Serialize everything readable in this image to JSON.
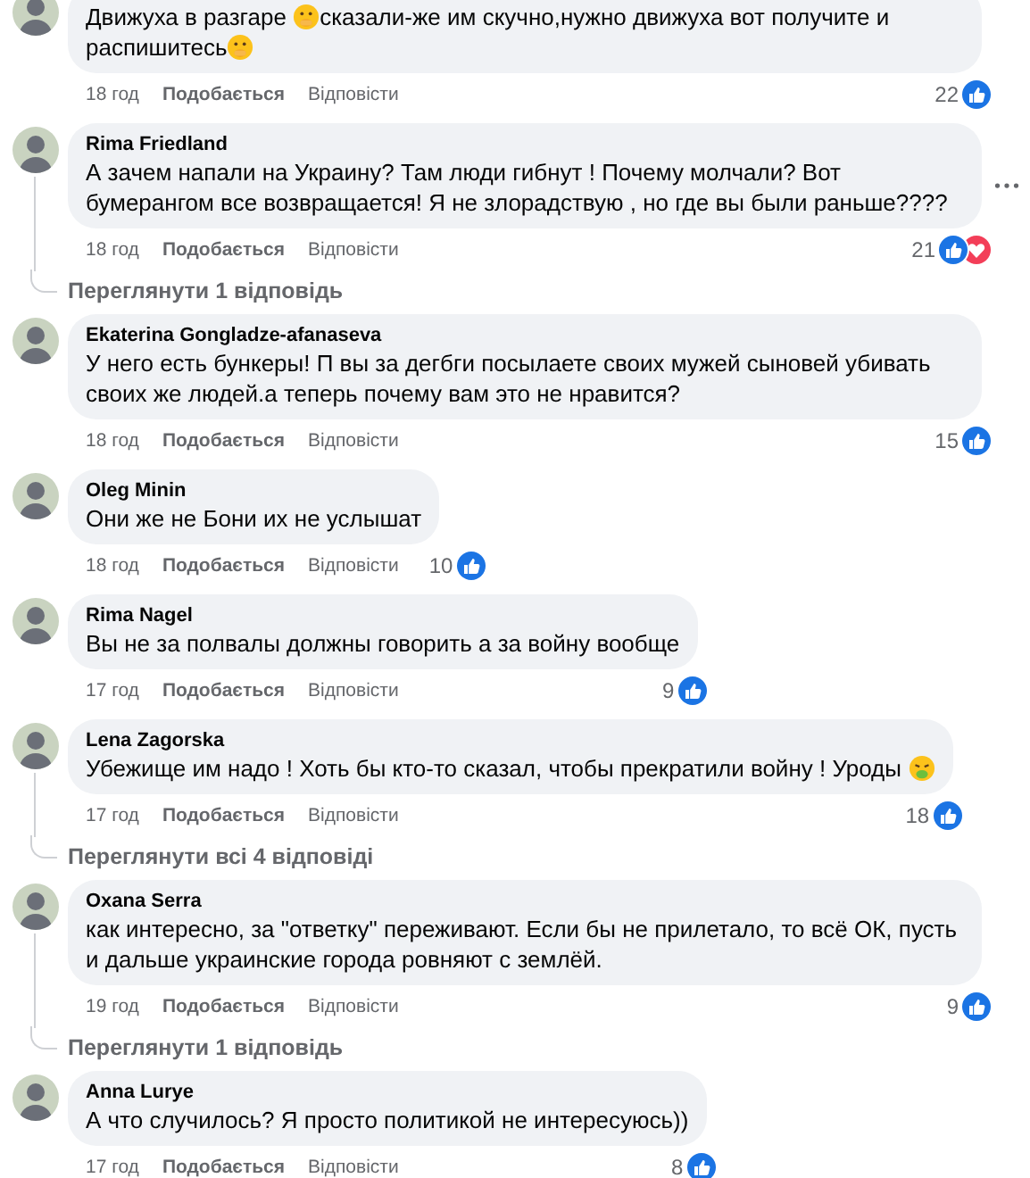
{
  "comments": [
    {
      "parts": [
        {
          "kind": "text",
          "text": "Движуха в разгаре "
        },
        {
          "kind": "emoji"
        },
        {
          "kind": "text",
          "text": "сказали-же им скучно,нужно движуха вот получите и распишитесь"
        },
        {
          "kind": "emoji"
        }
      ],
      "time": "18 год",
      "like": "Подобається",
      "reply": "Відповісти",
      "count": "22",
      "reactions": [
        {
          "kind": "like"
        }
      ],
      "menu": false
    },
    {
      "author": "Rima Friedland",
      "parts": [
        {
          "kind": "text",
          "text": "А зачем напали на Украину? Там люди гибнут ! Почему молчали? Вот бумерангом все возвращается! Я не злорадствую , но где вы были раньше????"
        }
      ],
      "time": "18 год",
      "like": "Подобається",
      "reply": "Відповісти",
      "count": "21",
      "reactions": [
        {
          "kind": "like"
        },
        {
          "kind": "love"
        }
      ],
      "menu": true,
      "replies_link": "Переглянути 1 відповідь"
    },
    {
      "author": "Ekaterina Gongladze-afanaseva",
      "parts": [
        {
          "kind": "text",
          "text": "У него есть бункеры! П вы за дегбги посылаете своих мужей сыновей убивать своих же людей.а теперь почему вам это не нравится?"
        }
      ],
      "time": "18 год",
      "like": "Подобається",
      "reply": "Відповісти",
      "count": "15",
      "reactions": [
        {
          "kind": "like"
        }
      ],
      "menu": false
    },
    {
      "author": "Oleg Minin",
      "parts": [
        {
          "kind": "text",
          "text": "Они же не Бони их не услышат"
        }
      ],
      "time": "18 год",
      "like": "Подобається",
      "reply": "Відповісти",
      "count": "10",
      "reactions": [
        {
          "kind": "like"
        }
      ],
      "menu": false
    },
    {
      "author": "Rima Nagel",
      "parts": [
        {
          "kind": "text",
          "text": "Вы не за полвалы должны говорить а за войну вообще"
        }
      ],
      "time": "17 год",
      "like": "Подобається",
      "reply": "Відповісти",
      "count": "9",
      "reactions": [
        {
          "kind": "like"
        }
      ],
      "menu": false
    },
    {
      "author": "Lena Zagorska",
      "parts": [
        {
          "kind": "text",
          "text": "Убежище им надо ! Хоть бы кто-то сказал, чтобы прекратили войну ! Уроды "
        },
        {
          "kind": "emoji_sick"
        }
      ],
      "time": "17 год",
      "like": "Подобається",
      "reply": "Відповісти",
      "count": "18",
      "reactions": [
        {
          "kind": "like"
        }
      ],
      "menu": false,
      "replies_link": "Переглянути всі 4 відповіді"
    },
    {
      "author": "Oxana Serra",
      "parts": [
        {
          "kind": "text",
          "text": "как интересно, за \"ответку\" переживают. Если бы не прилетало, то всё ОК, пусть и дальше украинские города ровняют с землёй."
        }
      ],
      "time": "19 год",
      "like": "Подобається",
      "reply": "Відповісти",
      "count": "9",
      "reactions": [
        {
          "kind": "like"
        }
      ],
      "menu": false,
      "replies_link": "Переглянути 1 відповідь"
    },
    {
      "author": "Anna Lurye",
      "parts": [
        {
          "kind": "text",
          "text": "А что случилось? Я просто политикой не интересуюсь))"
        }
      ],
      "time": "17 год",
      "like": "Подобається",
      "reply": "Відповісти",
      "count": "8",
      "reactions": [
        {
          "kind": "like"
        }
      ],
      "menu": false
    }
  ]
}
